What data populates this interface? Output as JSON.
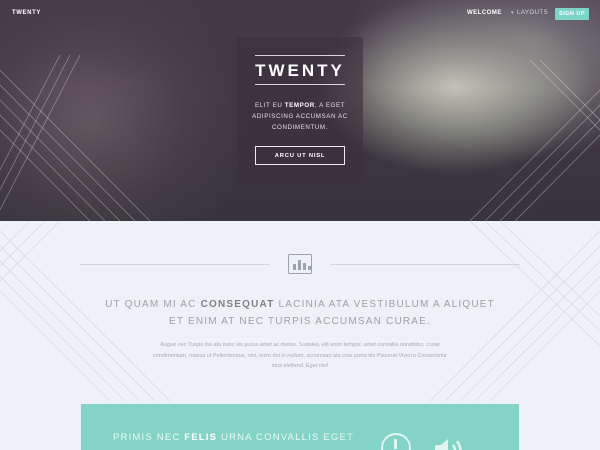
{
  "nav": {
    "brand": "TWENTY",
    "welcome": "WELCOME",
    "layouts": "LAYOUTS",
    "signup": "SIGN UP"
  },
  "hero": {
    "title": "TWENTY",
    "subtitle_pre": "ELIT EU ",
    "subtitle_bold": "TEMPOR",
    "subtitle_post": ", A EGET ADIPISCING ACCUMSAN AC CONDIMENTUM.",
    "button": "ARCU UT NISL"
  },
  "main": {
    "headline_pre": "UT QUAM MI AC ",
    "headline_bold": "CONSEQUAT",
    "headline_post": " LACINIA ATA VESTIBULUM A ALIQUET ET ENIM AT NEC TURPIS ACCUMSAN CURAE.",
    "body": "Augue nec Turpis dui ata nunc vis purus amet ac metus. Sodales, elit enim tempor, amet convallis ouratbitur, curae condimentum, massa ut Pellentesque, nisl, enim dui in nullam, accumsan ata cras porta dis Placerat Viverra Consectetur mus eleifend. Eget nisi!"
  },
  "feature": {
    "text_pre": "PRIMIS NEC ",
    "text_bold": "FELIS",
    "text_post": " URNA CONVALLIS EGET"
  },
  "colors": {
    "accent": "#7dd5c8",
    "band": "#83d4c6",
    "background": "#eef1f6"
  },
  "icons": [
    "chevron-down-icon",
    "bar-chart-icon",
    "clock-icon",
    "speaker-icon"
  ]
}
